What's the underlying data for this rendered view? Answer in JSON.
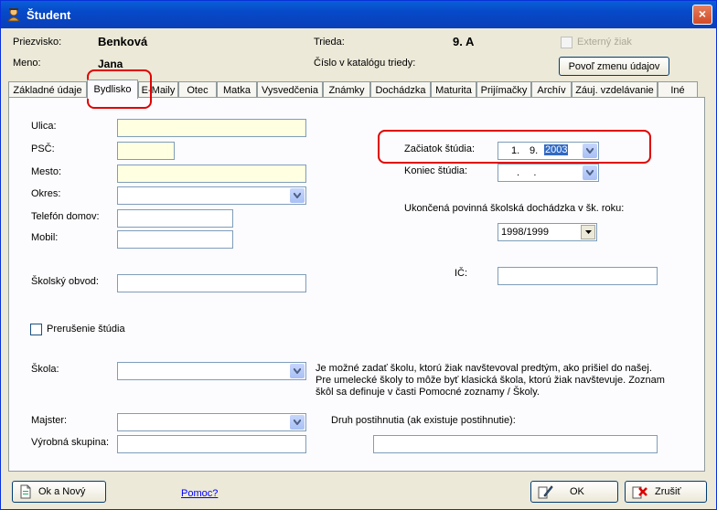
{
  "window": {
    "title": "Študent",
    "close_label": "×"
  },
  "header": {
    "priezvisko_label": "Priezvisko:",
    "priezvisko_value": "Benková",
    "meno_label": "Meno:",
    "meno_value": "Jana",
    "trieda_label": "Trieda:",
    "trieda_value": "9. A",
    "katalog_label": "Číslo v katalógu triedy:",
    "externy_label": "Externý žiak",
    "povol_button": "Povoľ zmenu údajov"
  },
  "tabs": [
    {
      "label": "Základné údaje"
    },
    {
      "label": "Bydlisko"
    },
    {
      "label": "E-Maily"
    },
    {
      "label": "Otec"
    },
    {
      "label": "Matka"
    },
    {
      "label": "Vysvedčenia"
    },
    {
      "label": "Známky"
    },
    {
      "label": "Dochádzka"
    },
    {
      "label": "Maturita"
    },
    {
      "label": "Prijímačky"
    },
    {
      "label": "Archív"
    },
    {
      "label": "Záuj. vzdelávanie"
    },
    {
      "label": "Iné"
    }
  ],
  "form": {
    "ulica_label": "Ulica:",
    "psc_label": "PSČ:",
    "mesto_label": "Mesto:",
    "okres_label": "Okres:",
    "telefon_label": "Telefón domov:",
    "mobil_label": "Mobil:",
    "skolsky_obvod_label": "Školský obvod:",
    "zaciatok_label": "Začiatok štúdia:",
    "zaciatok_day": "1.",
    "zaciatok_month": "9.",
    "zaciatok_year": "2003",
    "koniec_label": "Koniec štúdia:",
    "koniec_placeholder": ".     .",
    "ukoncena_label": "Ukončená povinná školská dochádzka v šk. roku:",
    "ukoncena_value": "1998/1999",
    "ic_label": "IČ:",
    "prerusenie_label": "Prerušenie štúdia",
    "skola_label": "Škola:",
    "skola_note_1": "Je možné zadať školu, ktorú žiak navštevoval predtým, ako prišiel do našej.",
    "skola_note_2": "Pre umelecké školy to môže byť klasická škola, ktorú žiak navštevuje. Zoznam",
    "skola_note_3": "škôl sa definuje v časti Pomocné zoznamy / Školy.",
    "majster_label": "Majster:",
    "druh_label": "Druh postihnutia (ak existuje postihnutie):",
    "vyrobna_label": "Výrobná skupina:"
  },
  "footer": {
    "ok_novy": "Ok a Nový",
    "pomoc": "Pomoc?",
    "ok": "OK",
    "zrusit": "Zrušiť"
  },
  "colors": {
    "title_bar": "#0649c8",
    "highlight_red": "#e00000",
    "required_field": "#ffffe1",
    "selection": "#316ac5"
  }
}
